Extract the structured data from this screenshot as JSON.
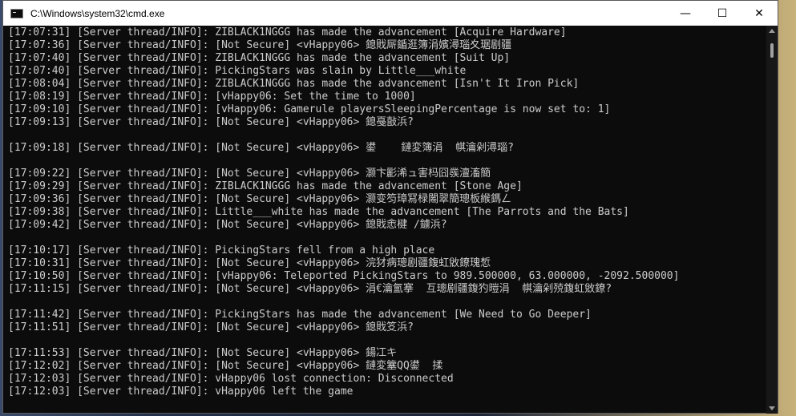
{
  "window": {
    "title": "C:\\Windows\\system32\\cmd.exe",
    "icon": "cmd-icon",
    "controls": {
      "minimize": "—",
      "maximize": "☐",
      "close": "✕"
    }
  },
  "console": {
    "lines": [
      "[17:07:31] [Server thread/INFO]: ZIBLACK1NGGG has made the advancement [Acquire Hardware]",
      "[17:07:36] [Server thread/INFO]: [Not Secure] <vHappy06> 鎴戝厛鍎逛簿涓嬪潯瑙夊琚剧疆",
      "[17:07:40] [Server thread/INFO]: ZIBLACK1NGGG has made the advancement [Suit Up]",
      "[17:07:40] [Server thread/INFO]: PickingStars was slain by Little___white",
      "[17:08:04] [Server thread/INFO]: ZIBLACK1NGGG has made the advancement [Isn't It Iron Pick]",
      "[17:08:19] [Server thread/INFO]: [vHappy06: Set the time to 1000]",
      "[17:09:10] [Server thread/INFO]: [vHappy06: Gamerule playersSleepingPercentage is now set to: 1]",
      "[17:09:13] [Server thread/INFO]: [Not Secure] <vHappy06> 鎴戞敼浜?",
      "",
      "[17:09:18] [Server thread/INFO]: [Not Secure] <vHappy06> 鍙    鏈変簿涓  帺瀹剁潯瑙?",
      "",
      "[17:09:22] [Server thread/INFO]: [Not Secure] <vHappy06> 灏卞彲浠ュ害杩囧彂澶滀簡",
      "[17:09:29] [Server thread/INFO]: ZIBLACK1NGGG has made the advancement [Stone Age]",
      "[17:09:36] [Server thread/INFO]: [Not Secure] <vHappy06> 灏变笉璋冩椂闂翠簡璁板緱鎷ㄥ",
      "[17:09:38] [Server thread/INFO]: Little___white has made the advancement [The Parrots and the Bats]",
      "[17:09:42] [Server thread/INFO]: [Not Secure] <vHappy06> 鎴戝悆楗 /鐪浜?",
      "",
      "[17:10:17] [Server thread/INFO]: PickingStars fell from a high place",
      "[17:10:31] [Server thread/INFO]: [Not Secure] <vHappy06> 浣犲病璁剧疆鍑虹敓鐐瑰惁",
      "[17:10:50] [Server thread/INFO]: [vHappy06: Teleported PickingStars to 989.500000, 63.000000, -2092.500000]",
      "[17:11:15] [Server thread/INFO]: [Not Secure] <vHappy06> 涓€瀹氳搴  互璁剧疆鍑犳暟涓  帺瀹剁殑鍑虹敓鐐?",
      "",
      "[17:11:42] [Server thread/INFO]: PickingStars has made the advancement [We Need to Go Deeper]",
      "[17:11:51] [Server thread/INFO]: [Not Secure] <vHappy06> 鎴戝笅浜?",
      "",
      "[17:11:53] [Server thread/INFO]: [Not Secure] <vHappy06> 鍚冮キ",
      "[17:12:02] [Server thread/INFO]: [Not Secure] <vHappy06> 鏈変簺QQ鍙  揉",
      "[17:12:03] [Server thread/INFO]: vHappy06 lost connection: Disconnected",
      "[17:12:03] [Server thread/INFO]: vHappy06 left the game"
    ]
  }
}
